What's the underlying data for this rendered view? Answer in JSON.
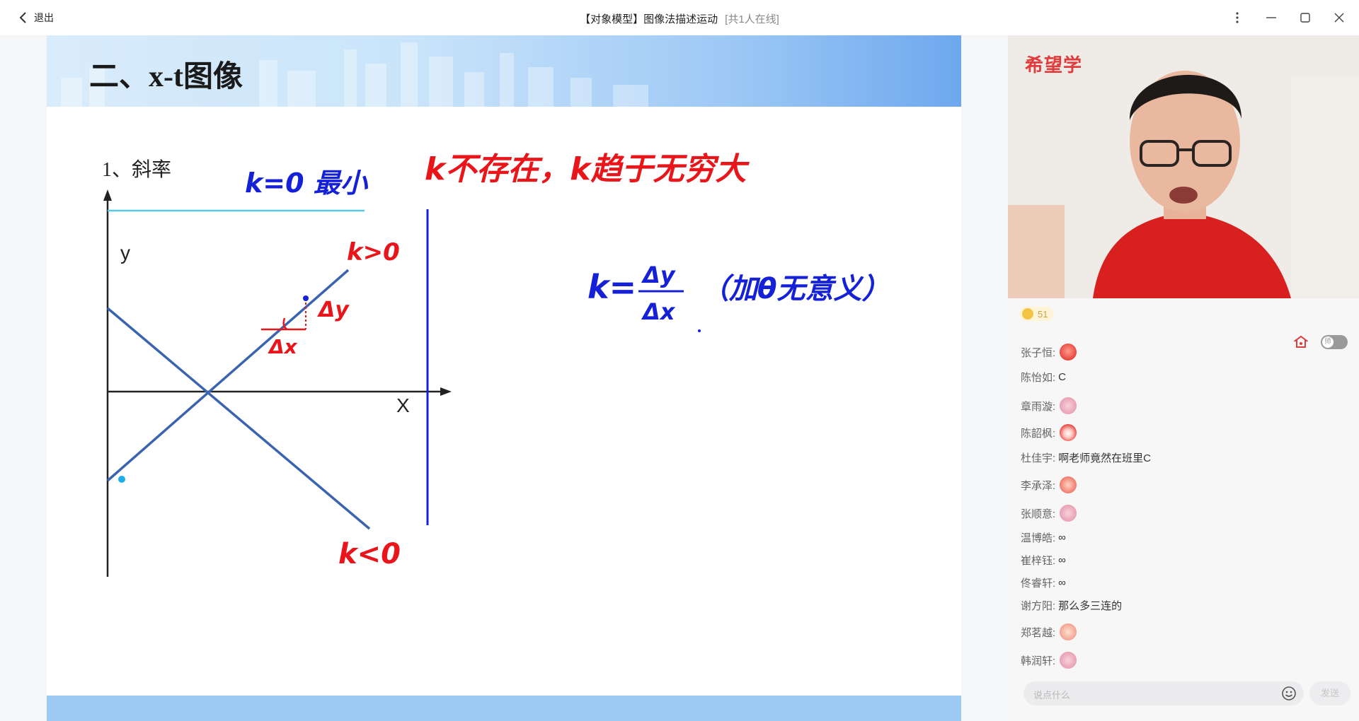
{
  "titlebar": {
    "exit_label": "退出",
    "title": "【对象模型】图像法描述运动",
    "online": "[共1人在线]"
  },
  "slide": {
    "title": "二、x-t图像",
    "subtitle": "1、斜率",
    "y_axis_label": "y",
    "x_axis_label": "X"
  },
  "annotations": {
    "blue_top": "k=0 最小",
    "red_top": "k不存在，k趋于无穷大",
    "k_positive": "k>0",
    "k_negative": "k<0",
    "delta_y": "Δy",
    "delta_x": "Δx",
    "formula_numerator": "Δy",
    "formula_k": "k=",
    "formula_denominator": "Δx",
    "formula_note": "（加θ无意义）"
  },
  "sidebar": {
    "brand": "希望学",
    "likes": "51",
    "send_label": "发送",
    "input_placeholder": "说点什么",
    "teacher_toggle": "师"
  },
  "chat": [
    {
      "name": "张子恒:",
      "text": "",
      "emoji": "face"
    },
    {
      "name": "陈怡如:",
      "text": "C",
      "emoji": ""
    },
    {
      "name": "章雨漩:",
      "text": "",
      "emoji": "rocket"
    },
    {
      "name": "陈韶枫:",
      "text": "",
      "emoji": "mouth"
    },
    {
      "name": "杜佳宇:",
      "text": "啊老师竟然在班里C",
      "emoji": ""
    },
    {
      "name": "李承泽:",
      "text": "",
      "emoji": "glasses"
    },
    {
      "name": "张顺意:",
      "text": "",
      "emoji": "rocket"
    },
    {
      "name": "温博皓:",
      "text": "∞",
      "emoji": ""
    },
    {
      "name": "崔梓钰:",
      "text": "∞",
      "emoji": ""
    },
    {
      "name": "佟睿轩:",
      "text": "∞",
      "emoji": ""
    },
    {
      "name": "谢方阳:",
      "text": "那么多三连的",
      "emoji": ""
    },
    {
      "name": "郑茗越:",
      "text": "",
      "emoji": "thumb"
    },
    {
      "name": "韩润轩:",
      "text": "",
      "emoji": "rocket"
    }
  ],
  "colors": {
    "ink_red": "#e8151b",
    "ink_blue": "#1521d6",
    "line_blue": "#3a64b0",
    "cyan": "#58c8ea",
    "brand_red": "#e23b3b"
  }
}
